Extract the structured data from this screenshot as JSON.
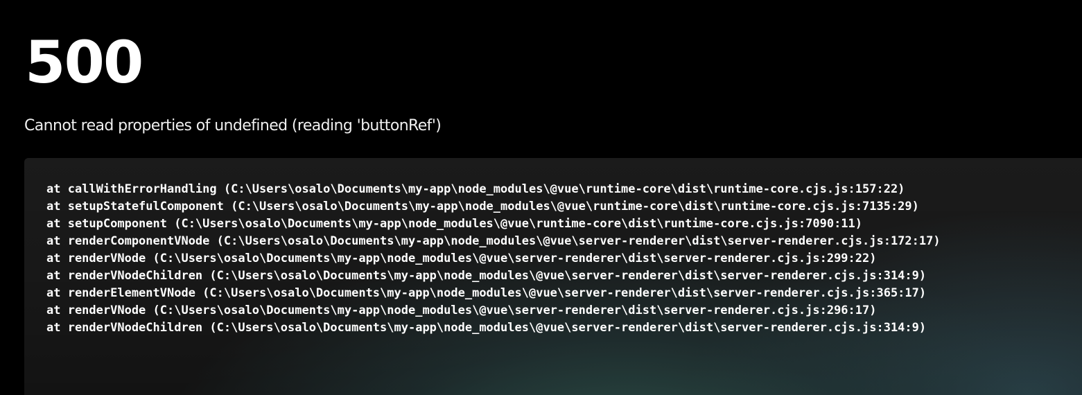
{
  "error": {
    "status_code": "500",
    "message": "Cannot read properties of undefined (reading 'buttonRef')"
  },
  "stack": [
    "at callWithErrorHandling (C:\\Users\\osalo\\Documents\\my-app\\node_modules\\@vue\\runtime-core\\dist\\runtime-core.cjs.js:157:22)",
    "at setupStatefulComponent (C:\\Users\\osalo\\Documents\\my-app\\node_modules\\@vue\\runtime-core\\dist\\runtime-core.cjs.js:7135:29)",
    "at setupComponent (C:\\Users\\osalo\\Documents\\my-app\\node_modules\\@vue\\runtime-core\\dist\\runtime-core.cjs.js:7090:11)",
    "at renderComponentVNode (C:\\Users\\osalo\\Documents\\my-app\\node_modules\\@vue\\server-renderer\\dist\\server-renderer.cjs.js:172:17)",
    "at renderVNode (C:\\Users\\osalo\\Documents\\my-app\\node_modules\\@vue\\server-renderer\\dist\\server-renderer.cjs.js:299:22)",
    "at renderVNodeChildren (C:\\Users\\osalo\\Documents\\my-app\\node_modules\\@vue\\server-renderer\\dist\\server-renderer.cjs.js:314:9)",
    "at renderElementVNode (C:\\Users\\osalo\\Documents\\my-app\\node_modules\\@vue\\server-renderer\\dist\\server-renderer.cjs.js:365:17)",
    "at renderVNode (C:\\Users\\osalo\\Documents\\my-app\\node_modules\\@vue\\server-renderer\\dist\\server-renderer.cjs.js:296:17)",
    "at renderVNodeChildren (C:\\Users\\osalo\\Documents\\my-app\\node_modules\\@vue\\server-renderer\\dist\\server-renderer.cjs.js:314:9)"
  ]
}
